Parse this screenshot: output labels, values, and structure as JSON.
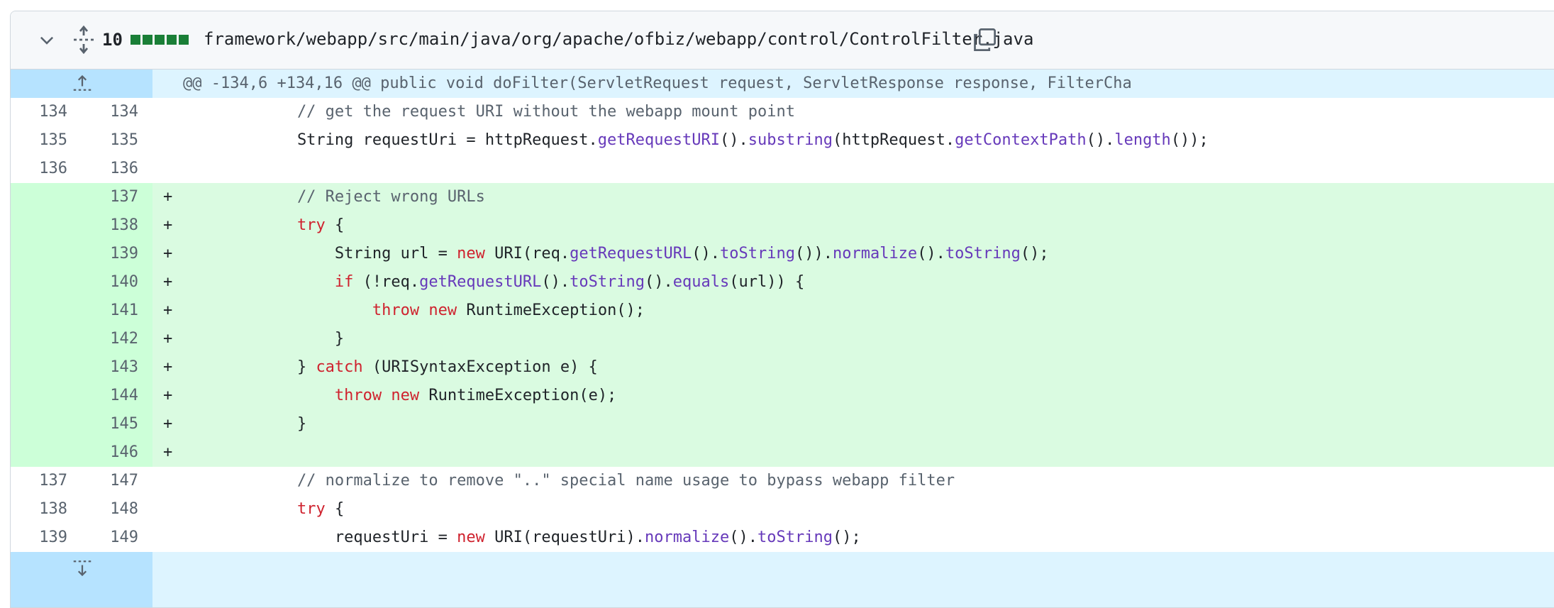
{
  "file": {
    "additions_count": "10",
    "path": "framework/webapp/src/main/java/org/apache/ofbiz/webapp/control/ControlFilter.java"
  },
  "hunk": {
    "header": "@@ -134,6 +134,16 @@ public void doFilter(ServletRequest request, ServletResponse response, FilterCha"
  },
  "lines": [
    {
      "old": "134",
      "new": "134",
      "marker": "",
      "type": "ctx"
    },
    {
      "old": "135",
      "new": "135",
      "marker": "",
      "type": "ctx"
    },
    {
      "old": "136",
      "new": "136",
      "marker": "",
      "type": "ctx"
    },
    {
      "old": "",
      "new": "137",
      "marker": "+",
      "type": "add"
    },
    {
      "old": "",
      "new": "138",
      "marker": "+",
      "type": "add"
    },
    {
      "old": "",
      "new": "139",
      "marker": "+",
      "type": "add"
    },
    {
      "old": "",
      "new": "140",
      "marker": "+",
      "type": "add"
    },
    {
      "old": "",
      "new": "141",
      "marker": "+",
      "type": "add"
    },
    {
      "old": "",
      "new": "142",
      "marker": "+",
      "type": "add"
    },
    {
      "old": "",
      "new": "143",
      "marker": "+",
      "type": "add"
    },
    {
      "old": "",
      "new": "144",
      "marker": "+",
      "type": "add"
    },
    {
      "old": "",
      "new": "145",
      "marker": "+",
      "type": "add"
    },
    {
      "old": "",
      "new": "146",
      "marker": "+",
      "type": "add"
    },
    {
      "old": "137",
      "new": "147",
      "marker": "",
      "type": "ctx"
    },
    {
      "old": "138",
      "new": "148",
      "marker": "",
      "type": "ctx"
    },
    {
      "old": "139",
      "new": "149",
      "marker": "",
      "type": "ctx"
    }
  ],
  "code": {
    "l0": {
      "t0": "            // get the request URI without the webapp mount point"
    },
    "l1": {
      "t0": "            String requestUri = httpRequest.",
      "t1": "getRequestURI",
      "t2": "().",
      "t3": "substring",
      "t4": "(httpRequest.",
      "t5": "getContextPath",
      "t6": "().",
      "t7": "length",
      "t8": "());"
    },
    "l2": {
      "t0": ""
    },
    "l3": {
      "t0": "            // Reject wrong URLs"
    },
    "l4": {
      "t0": "            ",
      "t1": "try",
      "t2": " {"
    },
    "l5": {
      "t0": "                String url = ",
      "t1": "new",
      "t2": " URI(req.",
      "t3": "getRequestURL",
      "t4": "().",
      "t5": "toString",
      "t6": "()).",
      "t7": "normalize",
      "t8": "().",
      "t9": "toString",
      "t10": "();"
    },
    "l6": {
      "t0": "                ",
      "t1": "if",
      "t2": " (!req.",
      "t3": "getRequestURL",
      "t4": "().",
      "t5": "toString",
      "t6": "().",
      "t7": "equals",
      "t8": "(url)) {"
    },
    "l7": {
      "t0": "                    ",
      "t1": "throw",
      "t2": " ",
      "t3": "new",
      "t4": " RuntimeException();"
    },
    "l8": {
      "t0": "                }"
    },
    "l9": {
      "t0": "            } ",
      "t1": "catch",
      "t2": " (URISyntaxException e) {"
    },
    "l10": {
      "t0": "                ",
      "t1": "throw",
      "t2": " ",
      "t3": "new",
      "t4": " RuntimeException(e);"
    },
    "l11": {
      "t0": "            }"
    },
    "l12": {
      "t0": ""
    },
    "l13": {
      "t0": "            // normalize to remove \"..\" special name usage to bypass webapp filter"
    },
    "l14": {
      "t0": "            ",
      "t1": "try",
      "t2": " {"
    },
    "l15": {
      "t0": "                requestUri = ",
      "t1": "new",
      "t2": " URI(requestUri).",
      "t3": "normalize",
      "t4": "().",
      "t5": "toString",
      "t6": "();"
    }
  },
  "icons": {
    "collapse": "chevron-down-icon",
    "expand_all": "unfold-icon",
    "copy": "copy-icon",
    "expand_up": "expand-up-icon",
    "expand_down": "expand-down-icon"
  },
  "colors": {
    "addition_bg": "#dafbe1",
    "addition_gutter": "#ccffd8",
    "hunk_bg": "#ddf4ff",
    "hunk_gutter": "#b6e3ff",
    "keyword": "#cf222e",
    "function": "#6639ba"
  }
}
